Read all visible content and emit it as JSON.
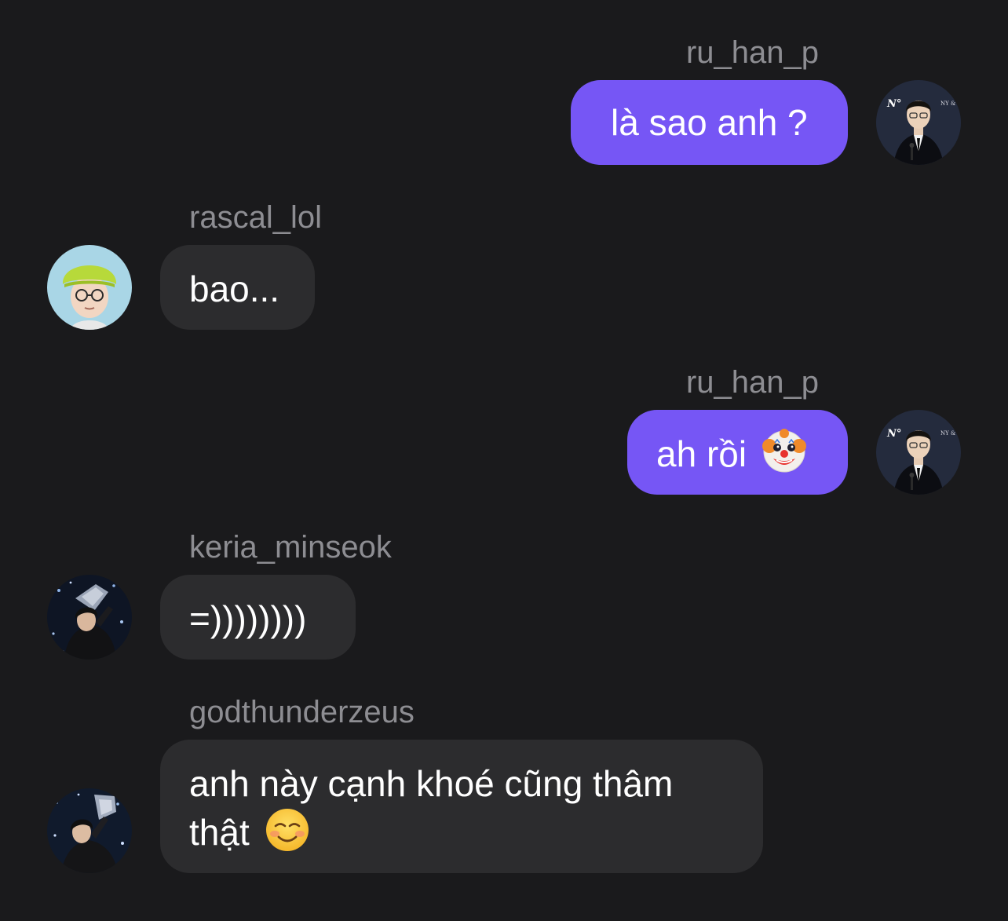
{
  "messages": [
    {
      "sender": "ru_han_p",
      "text": "là sao anh ?",
      "direction": "outgoing",
      "avatar_icon": "person-in-suit-avatar-icon"
    },
    {
      "sender": "rascal_lol",
      "text": "bao...",
      "direction": "incoming",
      "avatar_icon": "person-green-hat-glasses-avatar-icon"
    },
    {
      "sender": "ru_han_p",
      "text": "ah rồi",
      "emoji": "clown-face-emoji",
      "direction": "outgoing",
      "avatar_icon": "person-in-suit-avatar-icon"
    },
    {
      "sender": "keria_minseok",
      "text": "=))))))))",
      "direction": "incoming",
      "avatar_icon": "person-with-trophy-avatar-icon"
    },
    {
      "sender": "godthunderzeus",
      "text": "anh này cạnh khoé cũng thâm thật",
      "emoji": "smiling-face-emoji",
      "direction": "incoming",
      "avatar_icon": "person-with-trophy-avatar-icon"
    }
  ],
  "colors": {
    "background": "#1a1a1c",
    "outgoing_bubble": "#7656f5",
    "incoming_bubble": "#2c2c2e",
    "sender_name": "#8d8d92",
    "message_text": "#ffffff"
  }
}
